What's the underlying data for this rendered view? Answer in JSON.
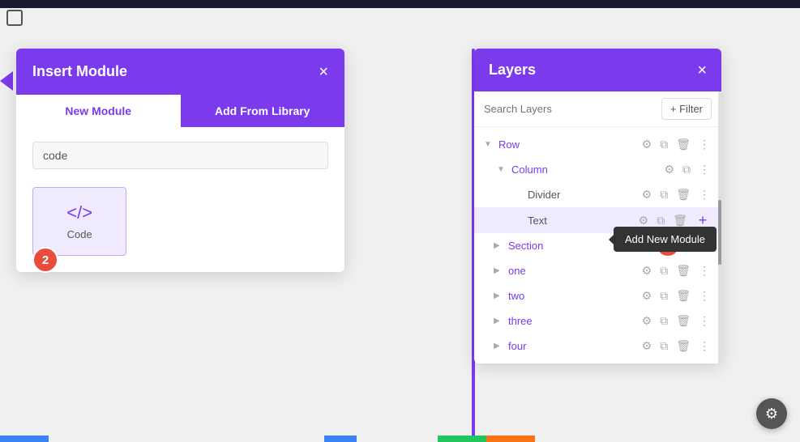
{
  "topbar": {},
  "insert_module_panel": {
    "title": "Insert Module",
    "close_label": "×",
    "tabs": [
      {
        "label": "New Module",
        "active": true
      },
      {
        "label": "Add From Library",
        "active": false
      }
    ],
    "search_placeholder": "code",
    "modules": [
      {
        "icon": "</>",
        "label": "Code",
        "highlighted": true
      }
    ]
  },
  "layers_panel": {
    "title": "Layers",
    "close_label": "×",
    "search_placeholder": "Search Layers",
    "filter_label": "+ Filter",
    "layers": [
      {
        "id": "row",
        "name": "Row",
        "indent": 0,
        "toggle": true,
        "color": "purple"
      },
      {
        "id": "column",
        "name": "Column",
        "indent": 1,
        "toggle": true,
        "color": "purple"
      },
      {
        "id": "divider",
        "name": "Divider",
        "indent": 2,
        "toggle": false,
        "color": "dark"
      },
      {
        "id": "text",
        "name": "Text",
        "indent": 2,
        "toggle": false,
        "color": "dark",
        "active": true
      },
      {
        "id": "section",
        "name": "Section",
        "indent": 0,
        "toggle": false,
        "color": "purple"
      },
      {
        "id": "one",
        "name": "one",
        "indent": 0,
        "toggle": false,
        "color": "purple"
      },
      {
        "id": "two",
        "name": "two",
        "indent": 0,
        "toggle": false,
        "color": "purple"
      },
      {
        "id": "three",
        "name": "three",
        "indent": 0,
        "toggle": false,
        "color": "purple"
      },
      {
        "id": "four",
        "name": "four",
        "indent": 0,
        "toggle": false,
        "color": "purple"
      }
    ]
  },
  "tooltip": {
    "label": "Add New Module"
  },
  "badges": {
    "badge1": "1",
    "badge2": "2"
  },
  "gear_icon": "⚙"
}
